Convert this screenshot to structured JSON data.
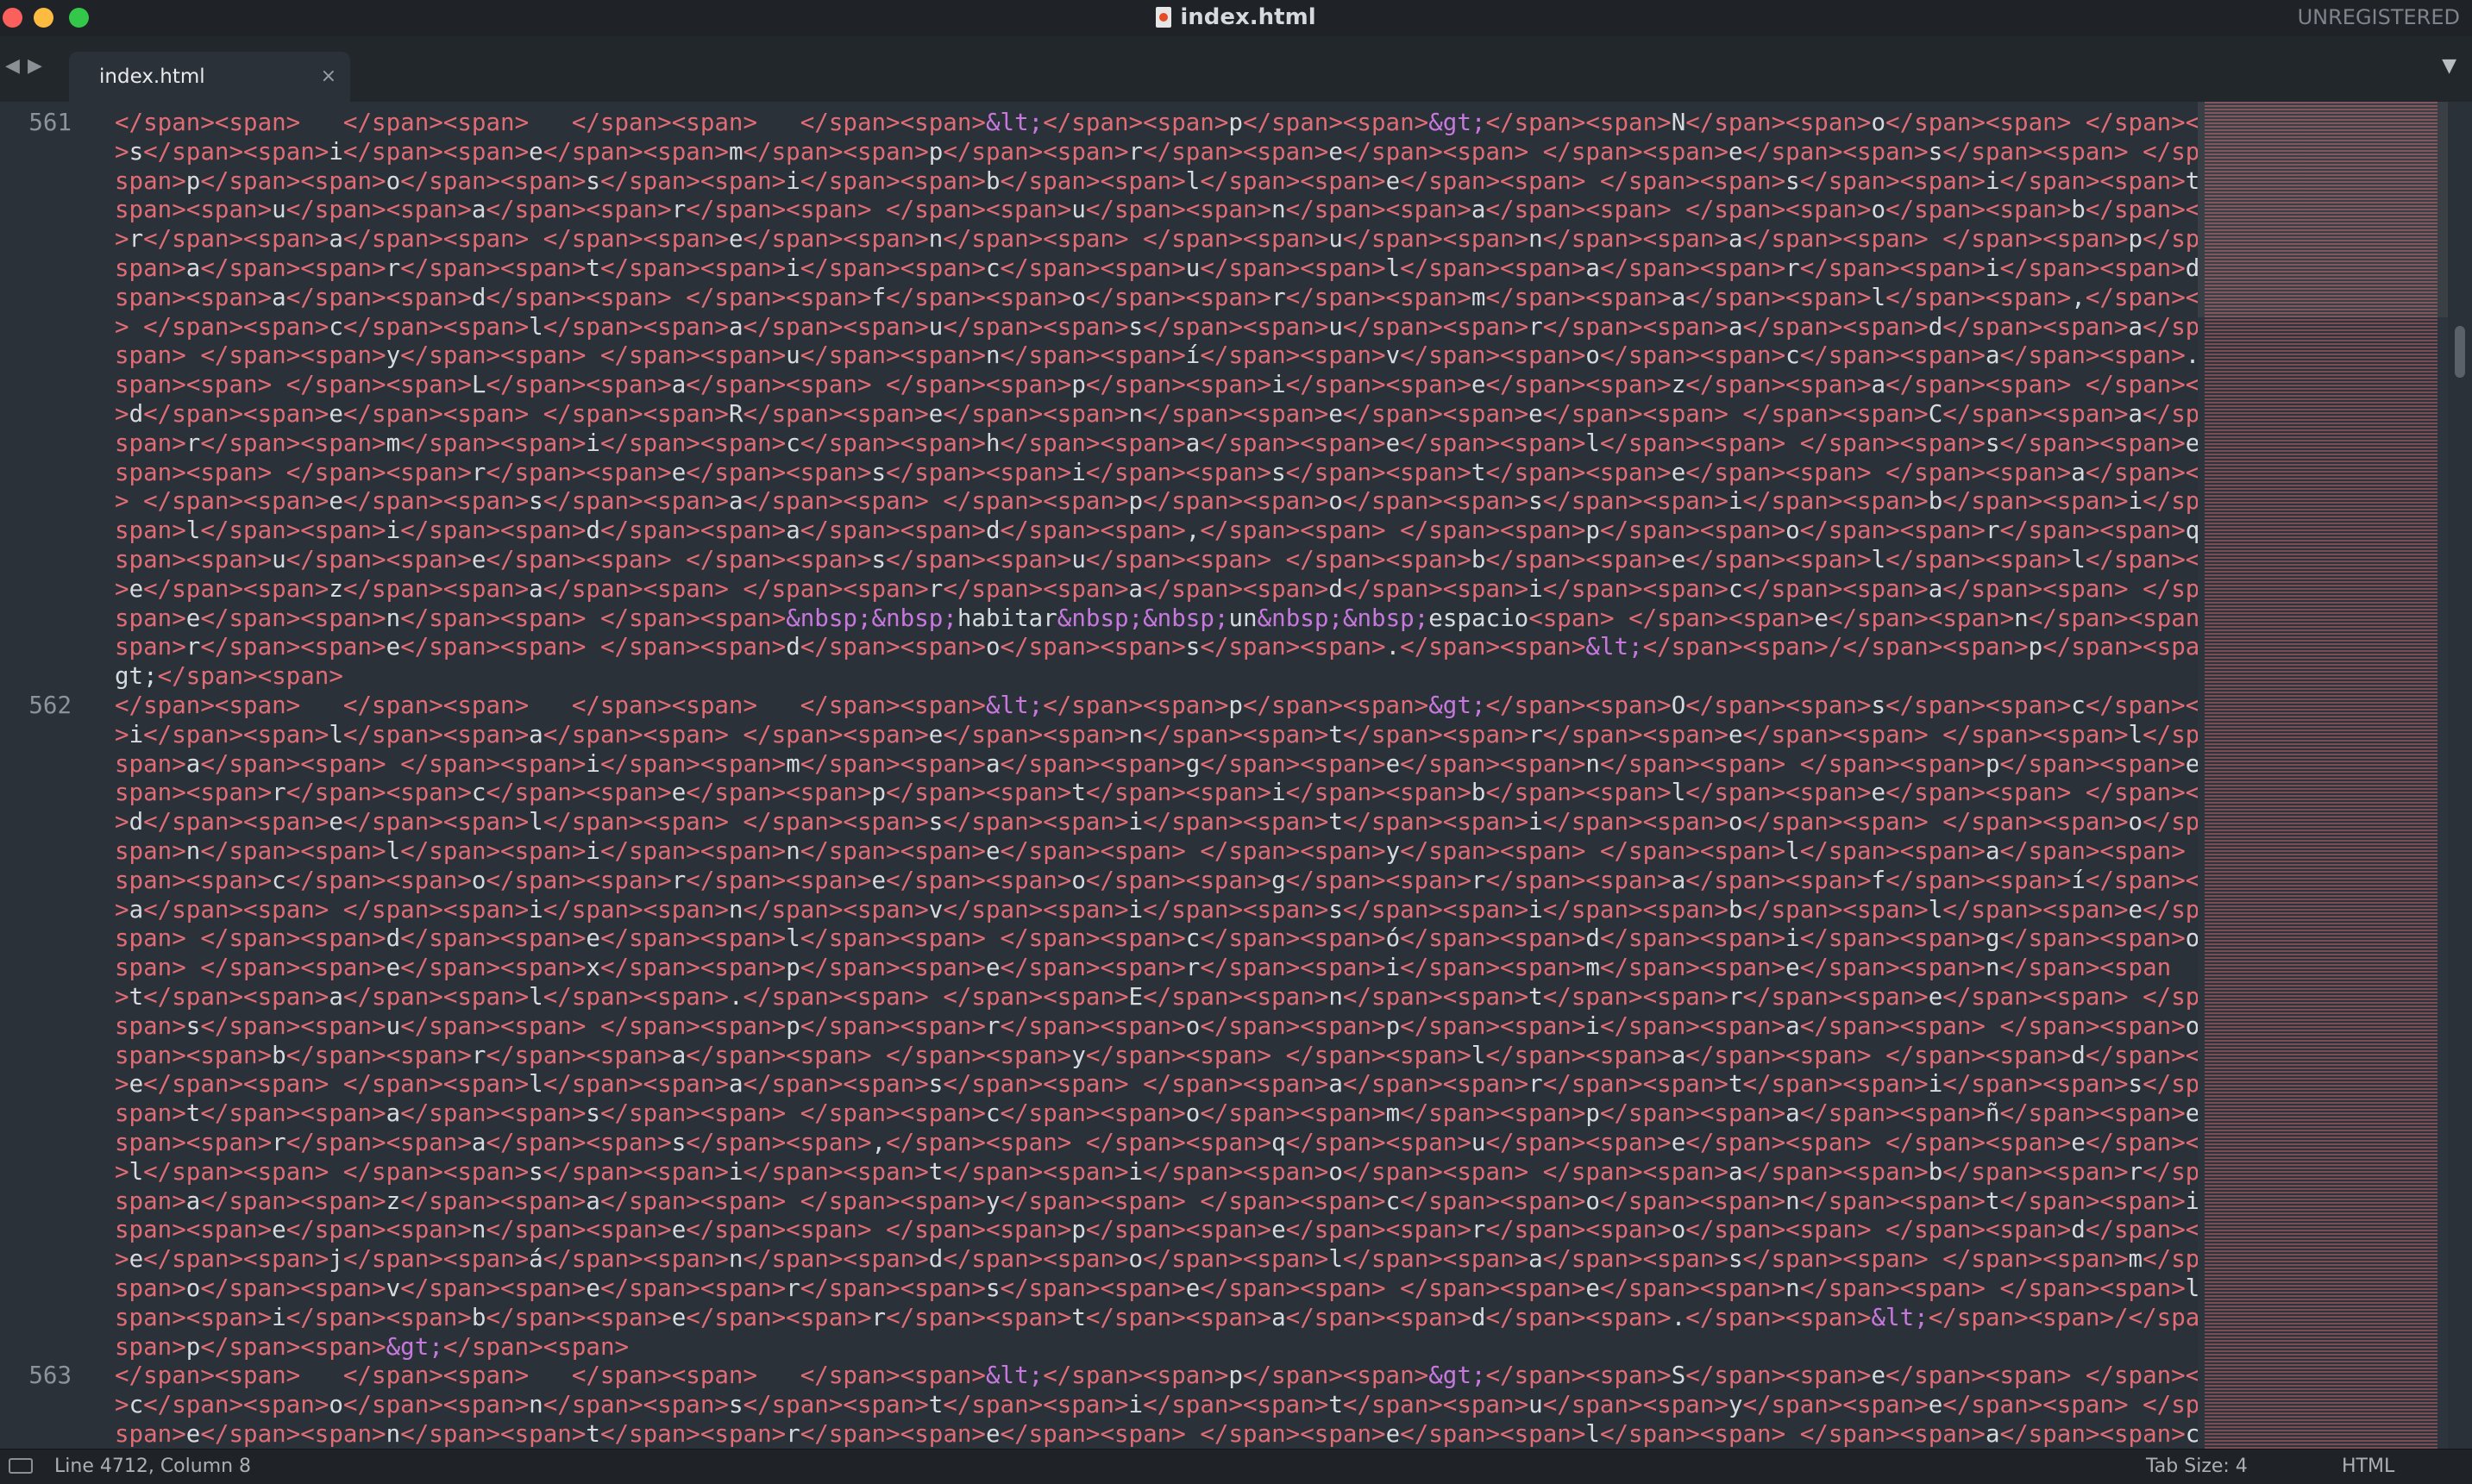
{
  "window": {
    "title": "index.html",
    "license": "UNREGISTERED"
  },
  "nav": {
    "back": "◀",
    "forward": "▶"
  },
  "tabs": [
    {
      "label": "index.html",
      "close": "×"
    }
  ],
  "tab_menu": "▼",
  "editor": {
    "line_numbers": [
      "561",
      "562",
      "563"
    ],
    "line_number_rows": [
      0,
      20,
      43
    ],
    "code_lines": [
      "</span><span>   </span><span>   </span><span>   </span><span>&lt;</span><span>p</span><span>&gt;</span><span>N</span><span>o</span><span> </span><span",
      ">s</span><span>i</span><span>e</span><span>m</span><span>p</span><span>r</span><span>e</span><span> </span><span>e</span><span>s</span><span> </span><",
      "span>p</span><span>o</span><span>s</span><span>i</span><span>b</span><span>l</span><span>e</span><span> </span><span>s</span><span>i</span><span>t</",
      "span><span>u</span><span>a</span><span>r</span><span> </span><span>u</span><span>n</span><span>a</span><span> </span><span>o</span><span>b</span><span",
      ">r</span><span>a</span><span> </span><span>e</span><span>n</span><span> </span><span>u</span><span>n</span><span>a</span><span> </span><span>p</span><",
      "span>a</span><span>r</span><span>t</span><span>i</span><span>c</span><span>u</span><span>l</span><span>a</span><span>r</span><span>i</span><span>d</",
      "span><span>a</span><span>d</span><span> </span><span>f</span><span>o</span><span>r</span><span>m</span><span>a</span><span>l</span><span>,</span><span",
      "> </span><span>c</span><span>l</span><span>a</span><span>u</span><span>s</span><span>u</span><span>r</span><span>a</span><span>d</span><span>a</span><",
      "span> </span><span>y</span><span> </span><span>u</span><span>n</span><span>í</span><span>v</span><span>o</span><span>c</span><span>a</span><span>.</",
      "span><span> </span><span>L</span><span>a</span><span> </span><span>p</span><span>i</span><span>e</span><span>z</span><span>a</span><span> </span><span",
      ">d</span><span>e</span><span> </span><span>R</span><span>e</span><span>n</span><span>e</span><span>e</span><span> </span><span>C</span><span>a</span><",
      "span>r</span><span>m</span><span>i</span><span>c</span><span>h</span><span>a</span><span>e</span><span>l</span><span> </span><span>s</span><span>e</",
      "span><span> </span><span>r</span><span>e</span><span>s</span><span>i</span><span>s</span><span>t</span><span>e</span><span> </span><span>a</span><span",
      "> </span><span>e</span><span>s</span><span>a</span><span> </span><span>p</span><span>o</span><span>s</span><span>i</span><span>b</span><span>i</span><",
      "span>l</span><span>i</span><span>d</span><span>a</span><span>d</span><span>,</span><span> </span><span>p</span><span>o</span><span>r</span><span>q</",
      "span><span>u</span><span>e</span><span> </span><span>s</span><span>u</span><span> </span><span>b</span><span>e</span><span>l</span><span>l</span><span",
      ">e</span><span>z</span><span>a</span><span> </span><span>r</span><span>a</span><span>d</span><span>i</span><span>c</span><span>a</span><span> </span><",
      "span>e</span><span>n</span><span> </span><span>&nbsp;&nbsp;habitar&nbsp;&nbsp;un&nbsp;&nbsp;espacio<span> </span><span>e</span><span>n</span><span>t</",
      "span>r</span><span>e</span><span> </span><span>d</span><span>o</span><span>s</span><span>.</span><span>&lt;</span><span>/</span><span>p</span><span>&",
      "gt;</span><span>",
      "</span><span>   </span><span>   </span><span>   </span><span>&lt;</span><span>p</span><span>&gt;</span><span>O</span><span>s</span><span>c</span><span",
      ">i</span><span>l</span><span>a</span><span> </span><span>e</span><span>n</span><span>t</span><span>r</span><span>e</span><span> </span><span>l</span><",
      "span>a</span><span> </span><span>i</span><span>m</span><span>a</span><span>g</span><span>e</span><span>n</span><span> </span><span>p</span><span>e</",
      "span><span>r</span><span>c</span><span>e</span><span>p</span><span>t</span><span>i</span><span>b</span><span>l</span><span>e</span><span> </span><span",
      ">d</span><span>e</span><span>l</span><span> </span><span>s</span><span>i</span><span>t</span><span>i</span><span>o</span><span> </span><span>o</span><",
      "span>n</span><span>l</span><span>i</span><span>n</span><span>e</span><span> </span><span>y</span><span> </span><span>l</span><span>a</span><span> </",
      "span><span>c</span><span>o</span><span>r</span><span>e</span><span>o</span><span>g</span><span>r</span><span>a</span><span>f</span><span>í</span><span",
      ">a</span><span> </span><span>i</span><span>n</span><span>v</span><span>i</span><span>s</span><span>i</span><span>b</span><span>l</span><span>e</span><",
      "span> </span><span>d</span><span>e</span><span>l</span><span> </span><span>c</span><span>ó</span><span>d</span><span>i</span><span>g</span><span>o</",
      "span> </span><span>e</span><span>x</span><span>p</span><span>e</span><span>r</span><span>i</span><span>m</span><span>e</span><span>n</span><span",
      ">t</span><span>a</span><span>l</span><span>.</span><span> </span><span>E</span><span>n</span><span>t</span><span>r</span><span>e</span><span> </span><",
      "span>s</span><span>u</span><span> </span><span>p</span><span>r</span><span>o</span><span>p</span><span>i</span><span>a</span><span> </span><span>o</",
      "span><span>b</span><span>r</span><span>a</span><span> </span><span>y</span><span> </span><span>l</span><span>a</span><span> </span><span>d</span><span",
      ">e</span><span> </span><span>l</span><span>a</span><span>s</span><span> </span><span>a</span><span>r</span><span>t</span><span>i</span><span>s</span><",
      "span>t</span><span>a</span><span>s</span><span> </span><span>c</span><span>o</span><span>m</span><span>p</span><span>a</span><span>ñ</span><span>e</",
      "span><span>r</span><span>a</span><span>s</span><span>,</span><span> </span><span>q</span><span>u</span><span>e</span><span> </span><span>e</span><span",
      ">l</span><span> </span><span>s</span><span>i</span><span>t</span><span>i</span><span>o</span><span> </span><span>a</span><span>b</span><span>r</span><",
      "span>a</span><span>z</span><span>a</span><span> </span><span>y</span><span> </span><span>c</span><span>o</span><span>n</span><span>t</span><span>i</",
      "span><span>e</span><span>n</span><span>e</span><span> </span><span>p</span><span>e</span><span>r</span><span>o</span><span> </span><span>d</span><span",
      ">e</span><span>j</span><span>á</span><span>n</span><span>d</span><span>o</span><span>l</span><span>a</span><span>s</span><span> </span><span>m</span><",
      "span>o</span><span>v</span><span>e</span><span>r</span><span>s</span><span>e</span><span> </span><span>e</span><span>n</span><span> </span><span>l</",
      "span><span>i</span><span>b</span><span>e</span><span>r</span><span>t</span><span>a</span><span>d</span><span>.</span><span>&lt;</span><span>/</span><",
      "span>p</span><span>&gt;</span><span>",
      "</span><span>   </span><span>   </span><span>   </span><span>&lt;</span><span>p</span><span>&gt;</span><span>S</span><span>e</span><span> </span><span",
      ">c</span><span>o</span><span>n</span><span>s</span><span>t</span><span>i</span><span>t</span><span>u</span><span>y</span><span>e</span><span> </span><",
      "span>e</span><span>n</span><span>t</span><span>r</span><span>e</span><span> </span><span>e</span><span>l</span><span> </span><span>a</span><span>c</"
    ]
  },
  "statusbar": {
    "position": "Line 4712, Column 8",
    "tab_size": "Tab Size: 4",
    "syntax": "HTML"
  },
  "colors": {
    "tag": "#e06c75",
    "entity": "#c678dd",
    "plain": "#d7dadf",
    "background": "#2b3138"
  }
}
